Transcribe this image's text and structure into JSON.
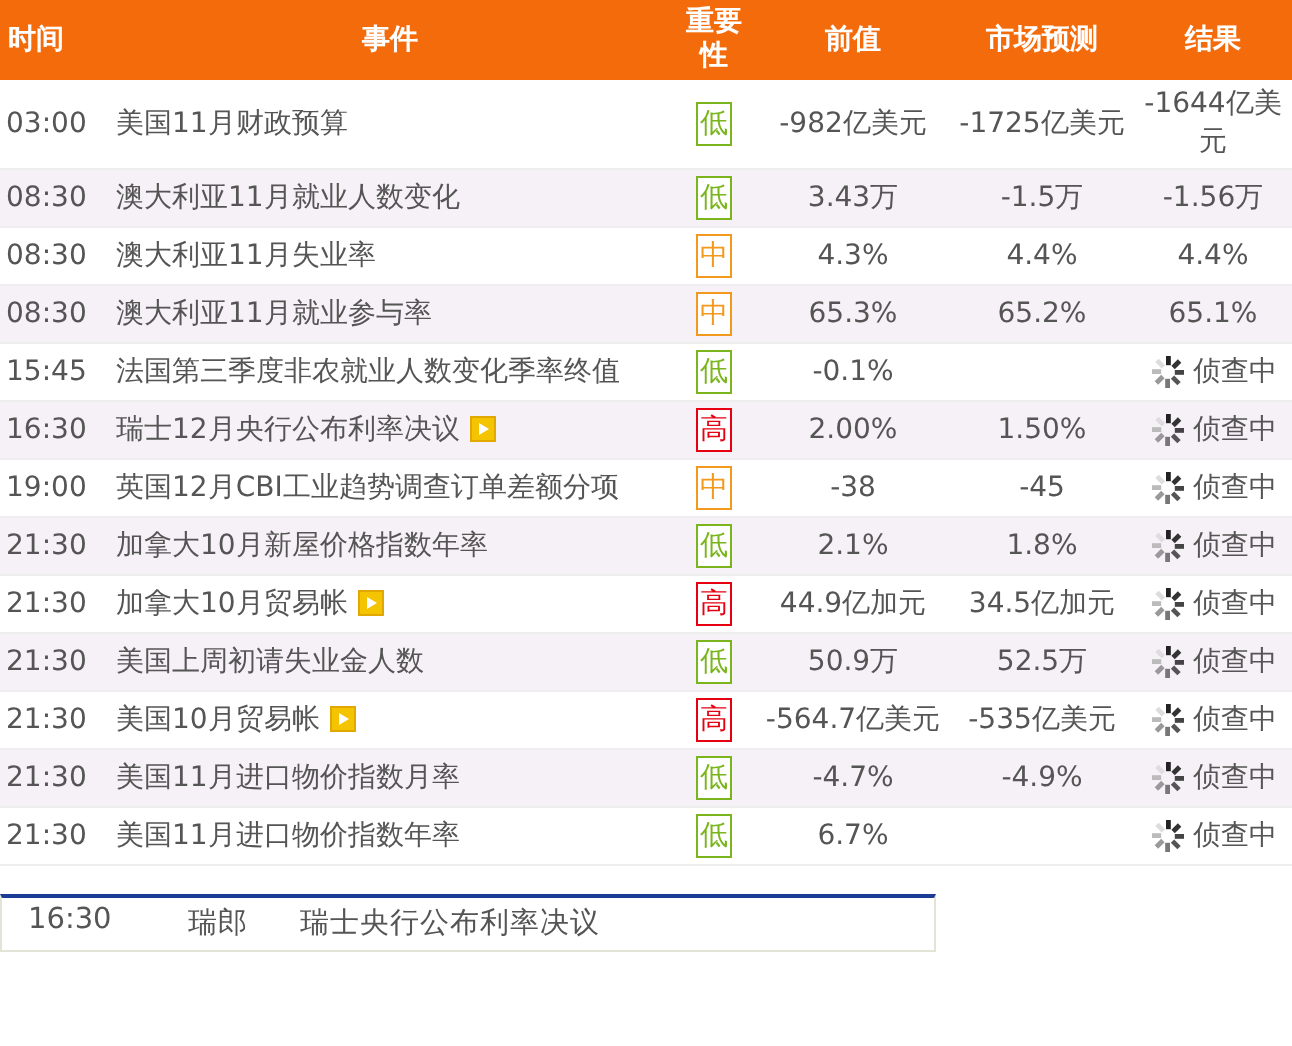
{
  "header": [
    "时间",
    "事件",
    "重要性",
    "前值",
    "市场预测",
    "结果"
  ],
  "rows": [
    {
      "time": "03:00",
      "event": "美国11月财政预算",
      "video": false,
      "importance": {
        "color": "#7ab51d",
        "text": "低"
      },
      "previous": "-982亿美元",
      "forecast": "-1725亿美元",
      "result": {
        "kind": "value",
        "text": "-1644亿美元"
      }
    },
    {
      "time": "08:30",
      "event": "澳大利亚11月就业人数变化",
      "video": false,
      "importance": {
        "color": "#7ab51d",
        "text": "低"
      },
      "previous": "3.43万",
      "forecast": "-1.5万",
      "result": {
        "kind": "value",
        "text": "-1.56万"
      }
    },
    {
      "time": "08:30",
      "event": "澳大利亚11月失业率",
      "video": false,
      "importance": {
        "color": "#f39a1e",
        "text": "中"
      },
      "previous": "4.3%",
      "forecast": "4.4%",
      "result": {
        "kind": "value",
        "text": "4.4%"
      }
    },
    {
      "time": "08:30",
      "event": "澳大利亚11月就业参与率",
      "video": false,
      "importance": {
        "color": "#f39a1e",
        "text": "中"
      },
      "previous": "65.3%",
      "forecast": "65.2%",
      "result": {
        "kind": "value",
        "text": "65.1%"
      }
    },
    {
      "time": "15:45",
      "event": "法国第三季度非农就业人数变化季率终值",
      "video": false,
      "importance": {
        "color": "#7ab51d",
        "text": "低"
      },
      "previous": "-0.1%",
      "result": {
        "kind": "pending",
        "text": "侦查中"
      }
    },
    {
      "time": "16:30",
      "event": "瑞士12月央行公布利率决议",
      "video": true,
      "importance": {
        "color": "#e60012",
        "text": "高"
      },
      "previous": "2.00%",
      "forecast": "1.50%",
      "result": {
        "kind": "pending",
        "text": "侦查中"
      }
    },
    {
      "time": "19:00",
      "event": "英国12月CBI工业趋势调查订单差额分项",
      "video": false,
      "importance": {
        "color": "#f39a1e",
        "text": "中"
      },
      "previous": "-38",
      "forecast": "-45",
      "result": {
        "kind": "pending",
        "text": "侦查中"
      }
    },
    {
      "time": "21:30",
      "event": "加拿大10月新屋价格指数年率",
      "video": false,
      "importance": {
        "color": "#7ab51d",
        "text": "低"
      },
      "previous": "2.1%",
      "forecast": "1.8%",
      "result": {
        "kind": "pending",
        "text": "侦查中"
      }
    },
    {
      "time": "21:30",
      "event": "加拿大10月贸易帐",
      "video": true,
      "importance": {
        "color": "#e60012",
        "text": "高"
      },
      "previous": "44.9亿加元",
      "forecast": "34.5亿加元",
      "result": {
        "kind": "pending",
        "text": "侦查中"
      }
    },
    {
      "time": "21:30",
      "event": "美国上周初请失业金人数",
      "video": false,
      "importance": {
        "color": "#7ab51d",
        "text": "低"
      },
      "previous": "50.9万",
      "forecast": "52.5万",
      "result": {
        "kind": "pending",
        "text": "侦查中"
      }
    },
    {
      "time": "21:30",
      "event": "美国10月贸易帐",
      "video": true,
      "importance": {
        "color": "#e60012",
        "text": "高"
      },
      "previous": "-564.7亿美元",
      "forecast": "-535亿美元",
      "result": {
        "kind": "pending",
        "text": "侦查中"
      }
    },
    {
      "time": "21:30",
      "event": "美国11月进口物价指数月率",
      "video": false,
      "importance": {
        "color": "#7ab51d",
        "text": "低"
      },
      "previous": "-4.7%",
      "forecast": "-4.9%",
      "result": {
        "kind": "pending",
        "text": "侦查中"
      }
    },
    {
      "time": "21:30",
      "event": "美国11月进口物价指数年率",
      "video": false,
      "importance": {
        "color": "#7ab51d",
        "text": "低"
      },
      "previous": "6.7%",
      "result": {
        "kind": "pending",
        "text": "侦查中"
      }
    }
  ],
  "popup": {
    "time": "16:30",
    "currency": "瑞郎",
    "event": "瑞士央行公布利率决议"
  }
}
